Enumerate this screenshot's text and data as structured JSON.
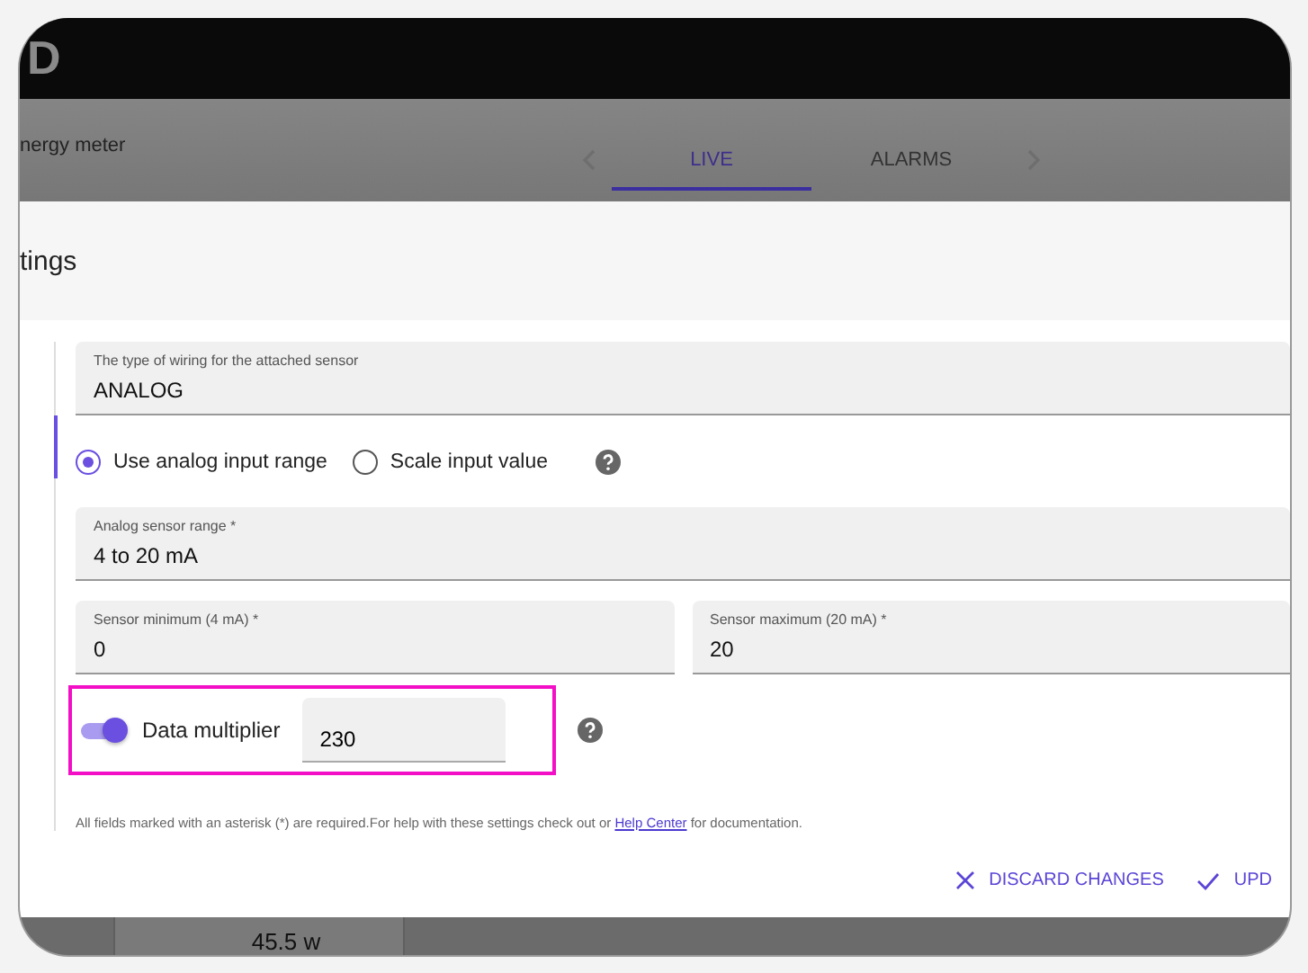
{
  "app": {
    "logo": "D",
    "device_name": "nergy meter"
  },
  "tabs": [
    {
      "label": "LIVE",
      "selected": true
    },
    {
      "label": "ALARMS",
      "selected": false
    }
  ],
  "dialog": {
    "title": "tings",
    "wiring_field": {
      "label": "The type of wiring for the attached sensor",
      "value": "ANALOG"
    },
    "range_mode": [
      {
        "label": "Use analog input range",
        "selected": true
      },
      {
        "label": "Scale input value",
        "selected": false
      }
    ],
    "range_field": {
      "label": "Analog sensor range *",
      "value": "4 to 20 mA"
    },
    "min_field": {
      "label": "Sensor minimum (4 mA) *",
      "value": "0"
    },
    "max_field": {
      "label": "Sensor maximum (20 mA) *",
      "value": "20"
    },
    "multiplier": {
      "label": "Data multiplier",
      "on": true,
      "value": "230",
      "highlighted": true
    },
    "footnote": {
      "text": "All fields marked with an asterisk (*) are required.For help with these settings check out or ",
      "link": "Help Center",
      "after": " for documentation."
    },
    "buttons": [
      {
        "label": "DISCARD CHANGES",
        "kind": "discard"
      },
      {
        "label": "UPD",
        "kind": "update"
      }
    ]
  },
  "background_card": {
    "value": "45.5 w"
  }
}
